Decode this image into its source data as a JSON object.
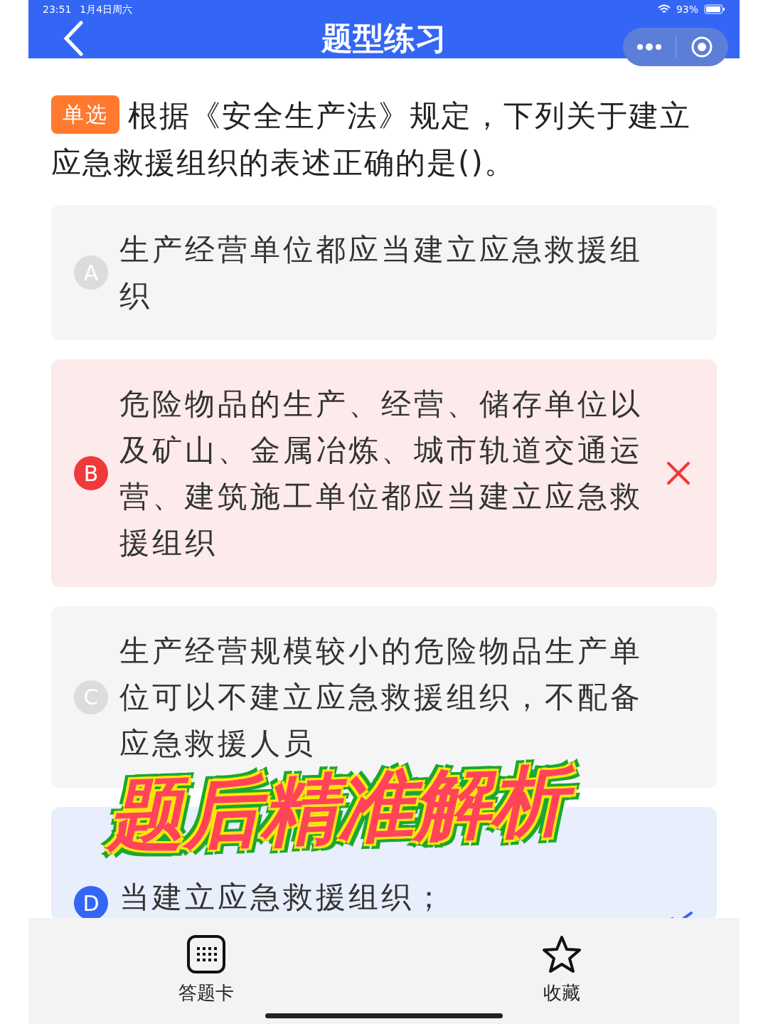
{
  "status_bar": {
    "time": "23:51",
    "date": "1月4日周六",
    "battery": "93%"
  },
  "header": {
    "title": "题型练习"
  },
  "question": {
    "type_badge": "单选",
    "text": "根据《安全生产法》规定，下列关于建立应急救援组织的表述正确的是()。"
  },
  "options": [
    {
      "letter": "A",
      "text": "生产经营单位都应当建立应急救援组织",
      "wrong": false,
      "correct": false
    },
    {
      "letter": "B",
      "text": "危险物品的生产、经营、储存单位以及矿山、金属冶炼、城市轨道交通运营、建筑施工单位都应当建立应急救援组织",
      "wrong": true,
      "correct": false
    },
    {
      "letter": "C",
      "text": "生产经营规模较小的危险物品生产单位可以不建立应急救援组织，不配备应急救援人员",
      "wrong": false,
      "correct": false
    },
    {
      "letter": "D",
      "text": "当建立应急救援组织；",
      "wrong": false,
      "correct": true
    }
  ],
  "overlay_caption": "题后精准解析",
  "bottom_bar": [
    {
      "kind": "grid",
      "label": "答题卡"
    },
    {
      "kind": "star",
      "label": "收藏"
    }
  ]
}
